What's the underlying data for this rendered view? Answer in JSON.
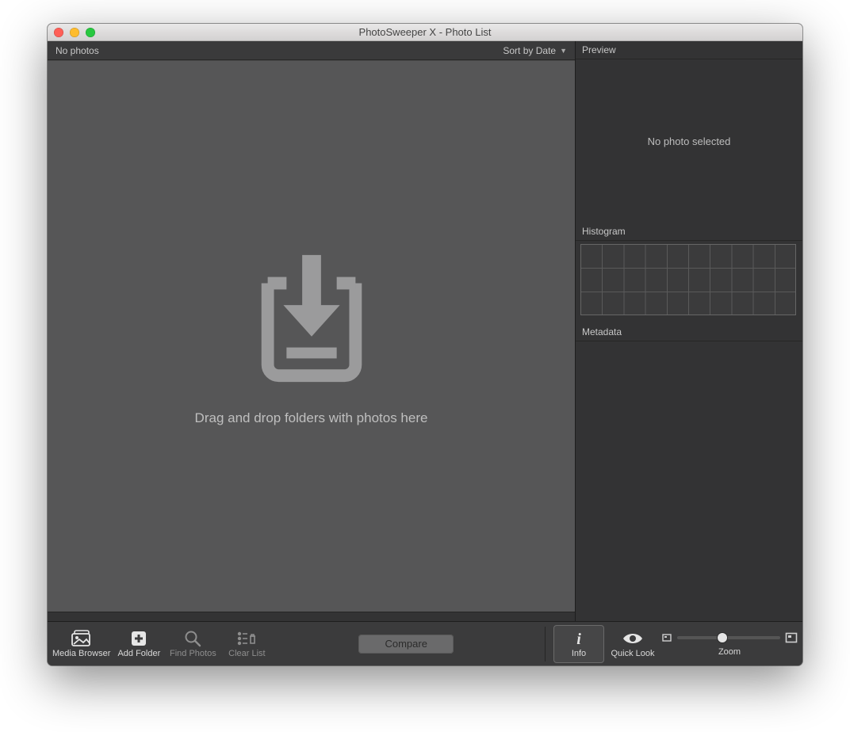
{
  "window": {
    "title": "PhotoSweeper X - Photo List"
  },
  "photo_list": {
    "count_label": "No photos",
    "sort_label": "Sort by Date",
    "drop_hint": "Drag and drop folders with photos here"
  },
  "inspector": {
    "preview_heading": "Preview",
    "preview_empty": "No photo selected",
    "histogram_heading": "Histogram",
    "metadata_heading": "Metadata"
  },
  "toolbar": {
    "media_browser": "Media Browser",
    "add_folder": "Add Folder",
    "find_photos": "Find Photos",
    "clear_list": "Clear List",
    "compare": "Compare",
    "info": "Info",
    "quick_look": "Quick Look",
    "zoom": "Zoom"
  }
}
